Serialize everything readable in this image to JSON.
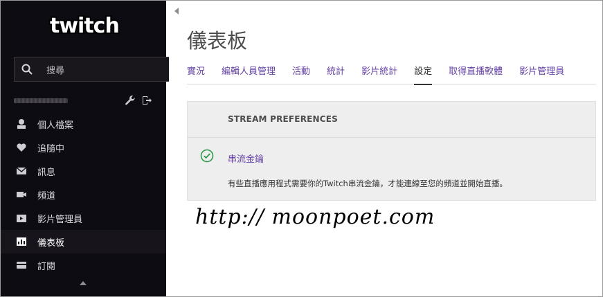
{
  "sidebar": {
    "logo": "twitch",
    "search_placeholder": "搜尋",
    "nav": [
      {
        "label": "個人檔案",
        "icon": "profile-icon"
      },
      {
        "label": "追隨中",
        "icon": "heart-icon"
      },
      {
        "label": "訊息",
        "icon": "envelope-icon"
      },
      {
        "label": "頻道",
        "icon": "video-camera-icon"
      },
      {
        "label": "影片管理員",
        "icon": "video-manager-icon"
      },
      {
        "label": "儀表板",
        "icon": "dashboard-icon"
      },
      {
        "label": "訂閱",
        "icon": "card-icon"
      }
    ],
    "active_item": "儀表板"
  },
  "main": {
    "title": "儀表板",
    "tabs": [
      {
        "label": "實況"
      },
      {
        "label": "編輯人員管理"
      },
      {
        "label": "活動"
      },
      {
        "label": "統計"
      },
      {
        "label": "影片統計"
      },
      {
        "label": "設定"
      },
      {
        "label": "取得直播軟體"
      },
      {
        "label": "影片管理員"
      }
    ],
    "active_tab": "設定",
    "panel": {
      "title": "STREAM PREFERENCES",
      "setting_label": "串流金鑰",
      "setting_desc": "有些直播應用程式需要你的Twitch串流金鑰，才能連線至您的頻道並開始直播。"
    }
  },
  "watermark": "http:// moonpoet.com",
  "colors": {
    "sidebar_bg": "#0e0c13",
    "accent": "#6441a4",
    "panel_bg": "#efeeef",
    "check": "#2e9a4a"
  }
}
